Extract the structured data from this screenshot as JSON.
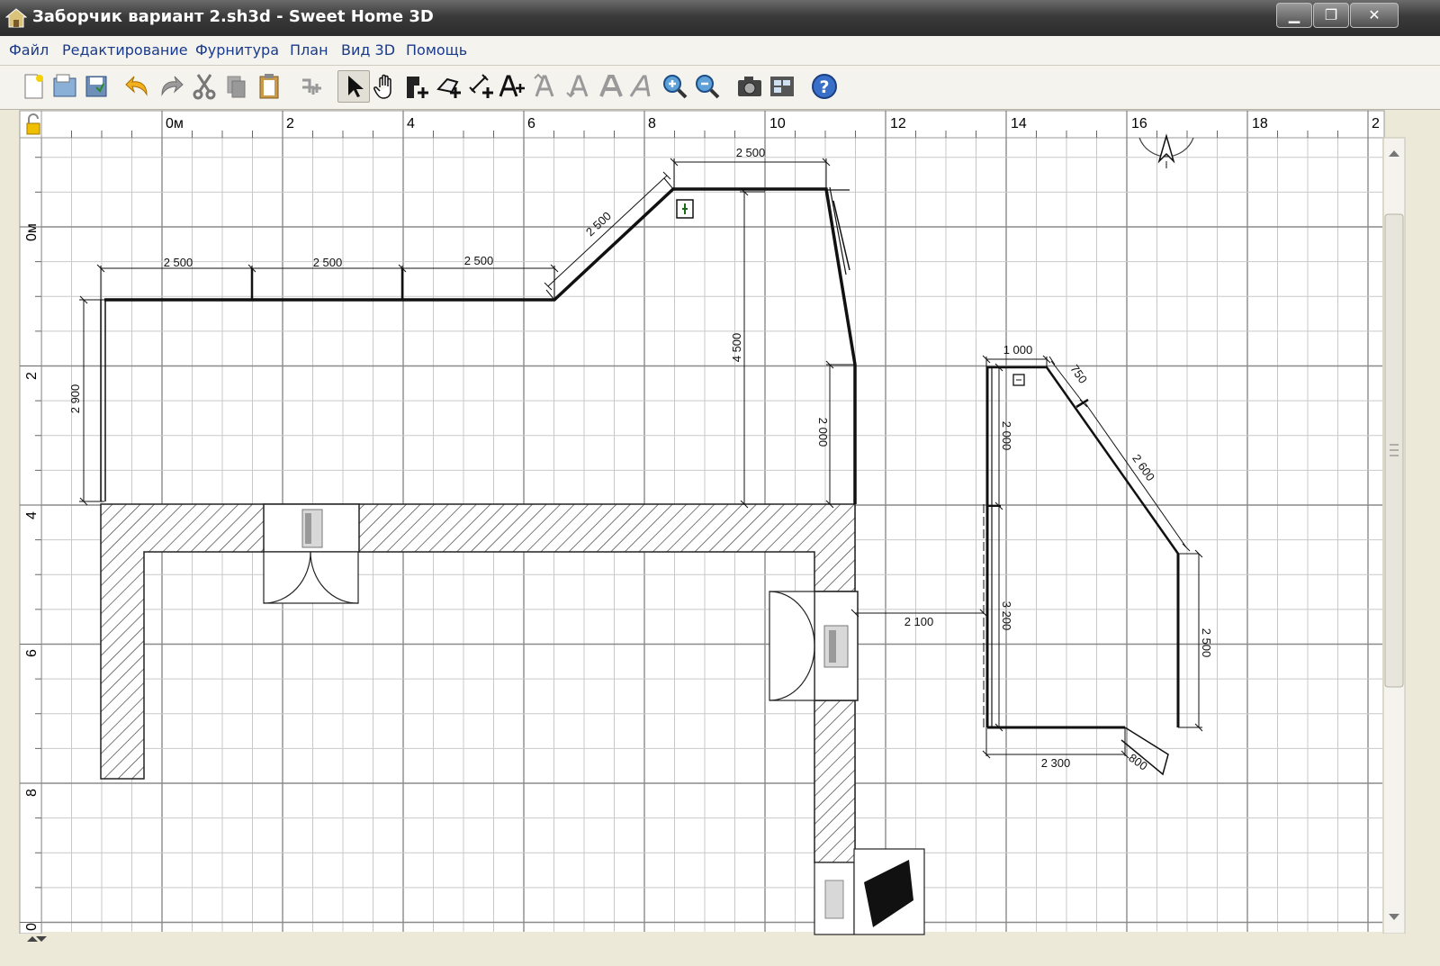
{
  "window": {
    "title": "Заборчик вариант 2.sh3d - Sweet Home 3D",
    "minimize": "▁",
    "maximize": "❐",
    "close": "✕"
  },
  "menu": [
    "Файл",
    "Редактирование",
    "Фурнитура",
    "План",
    "Вид 3D",
    "Помощь"
  ],
  "toolbar": {
    "buttons": [
      "new-file",
      "open-file",
      "save-file",
      "undo",
      "redo",
      "cut",
      "copy",
      "paste",
      "add-furniture",
      "select-mode",
      "pan-mode",
      "create-walls",
      "create-rooms",
      "create-dimensions",
      "add-text",
      "increase-text",
      "decrease-text",
      "bold-text",
      "italic-text",
      "zoom-in",
      "zoom-out",
      "create-photo",
      "create-video",
      "help"
    ],
    "selected": "select-mode"
  },
  "plan": {
    "top_ruler_labels": [
      "0м",
      "2",
      "4",
      "6",
      "8",
      "10",
      "12",
      "14",
      "16",
      "18",
      "2"
    ],
    "left_ruler_labels": [
      "0м",
      "2",
      "4",
      "6",
      "8",
      "0"
    ],
    "dimensions": {
      "top_a": "2 500",
      "top_b": "2 500",
      "top_c": "2 500",
      "diag": "2 500",
      "top_right": "2 500",
      "left_vertical": "2 900",
      "middle_vertical": "4 500",
      "right_vertical": "2 000",
      "gap": "2 100",
      "r_top": "1 000",
      "r_diag_small": "750",
      "r_diag_large": "2 600",
      "r_left_top": "2 000",
      "r_left_bottom": "3 200",
      "r_right": "2 500",
      "r_bottom": "2 300",
      "r_corner": "800"
    }
  }
}
